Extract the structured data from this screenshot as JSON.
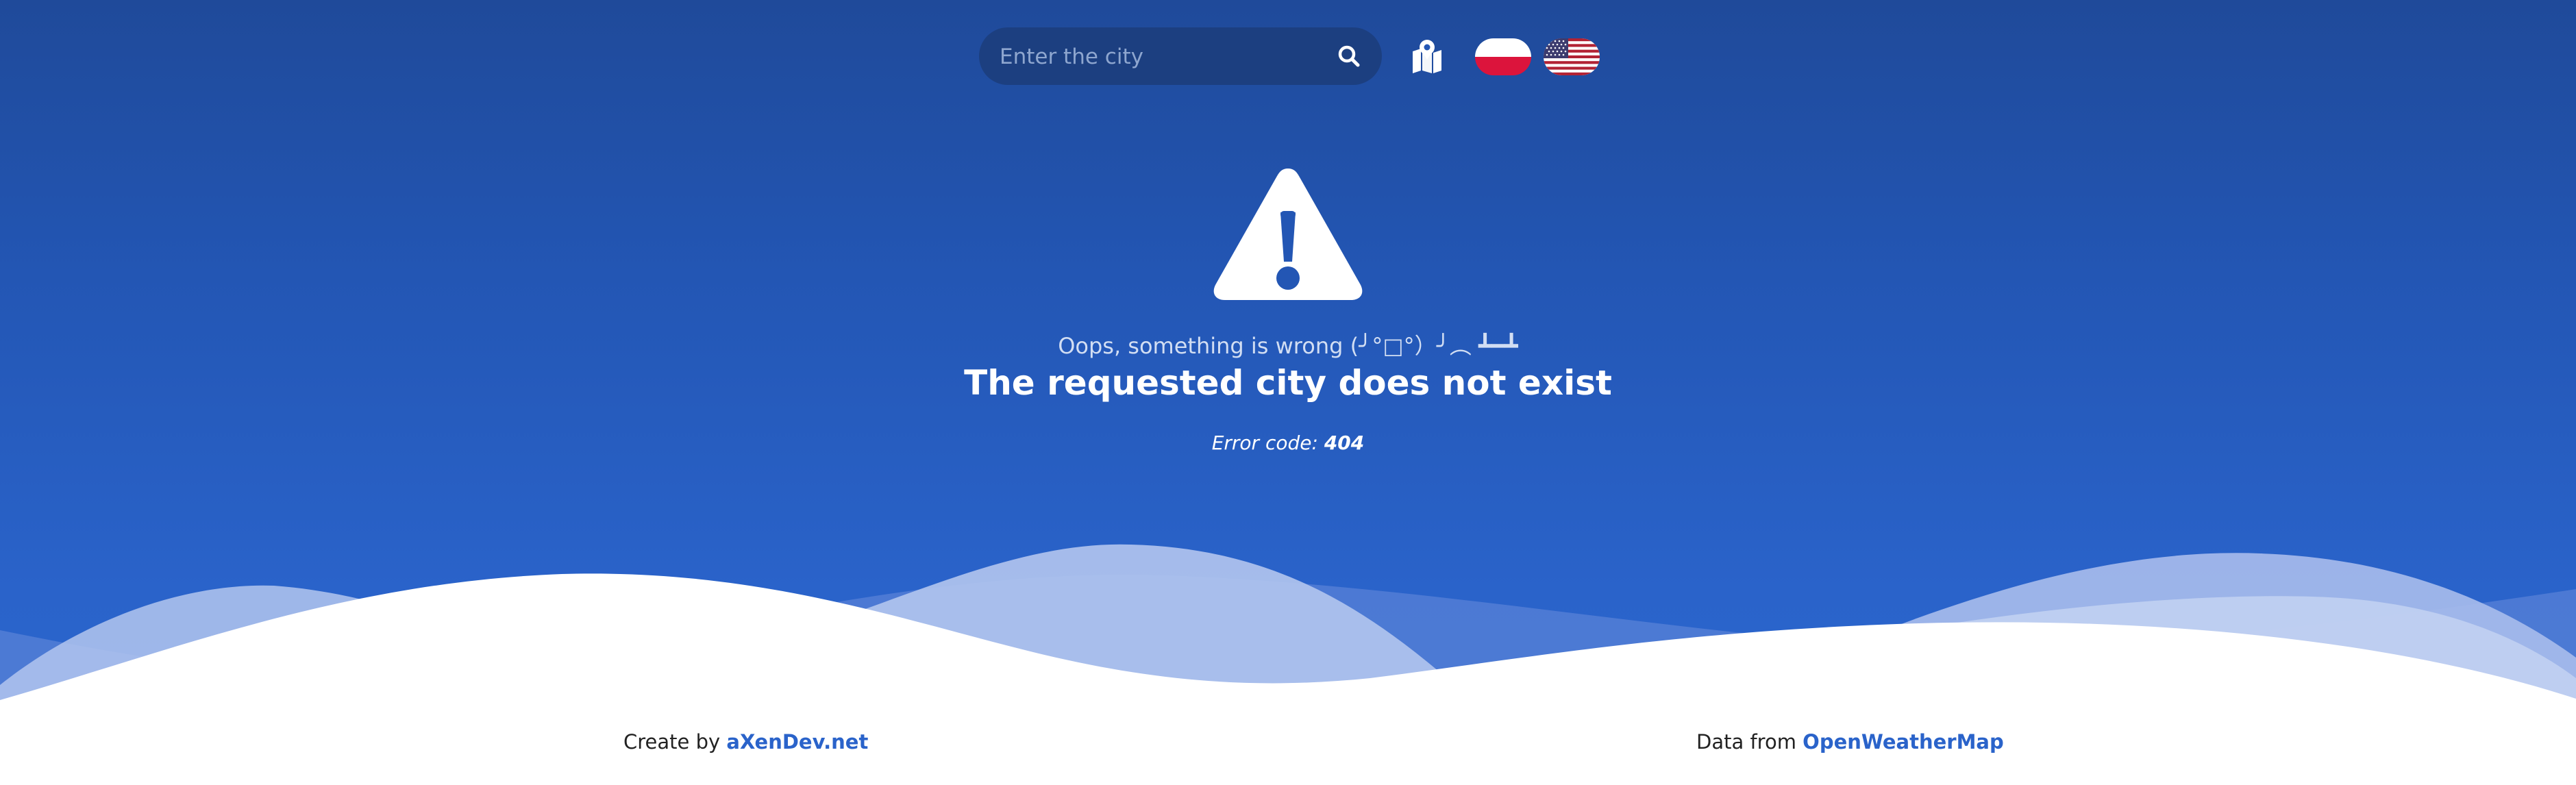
{
  "search": {
    "placeholder": "Enter the city",
    "value": ""
  },
  "icons": {
    "search": "search-icon",
    "map": "map-pin-icon",
    "flag_pl": "poland-flag-icon",
    "flag_us": "usa-flag-icon",
    "warning": "warning-triangle-icon"
  },
  "error": {
    "oops_text": "Oops, something is wrong (╯°□°）╯︵ ┻━┻",
    "title": "The requested city does not exist",
    "code_label": "Error code:",
    "code_value": "404"
  },
  "footer": {
    "create_by_label": "Create by",
    "create_by_link": "aXenDev.net",
    "data_from_label": "Data from",
    "data_from_link": "OpenWeatherMap"
  },
  "colors": {
    "background_top": "#1f4a9a",
    "background_bottom": "#2b66cf",
    "search_bg": "#1c3f80",
    "accent_link": "#2a63ca",
    "wave_light": "#b3c5ee",
    "wave_mid": "#8faae2"
  }
}
